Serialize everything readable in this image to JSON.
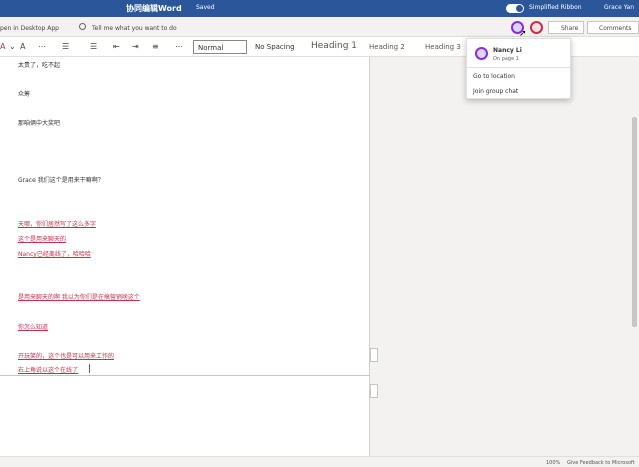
{
  "titlebar": {
    "doc_title": "协同编辑Word",
    "saved": "Saved",
    "simplified_ribbon": "Simplified Ribbon",
    "user": "Grace Yan"
  },
  "ribbon1": {
    "open_desktop": "pen in Desktop App",
    "tell_me": "Tell me what you want to do",
    "share": "Share",
    "comments": "Comments"
  },
  "ribbon2": {
    "styles": [
      "Normal",
      "No Spacing",
      "Heading 1",
      "Heading 2",
      "Heading 3"
    ]
  },
  "document": {
    "lines": [
      {
        "text": "太贵了，吃不起",
        "style": "black"
      },
      {
        "text": "众筹",
        "style": "black"
      },
      {
        "text": "那咱俩中大奖吧",
        "style": "black"
      },
      {
        "text": "Grace 我们这个是用来干嘛啊？",
        "style": "black"
      },
      {
        "text": "天哪，你们居然写了这么多字",
        "style": "red"
      },
      {
        "text": "这个是用来聊天的",
        "style": "red"
      },
      {
        "text": "Nancy已经离线了，哈哈哈",
        "style": "red"
      },
      {
        "text": "是用来聊天的啊 我以为你们是在搞营销啥这个",
        "style": "red"
      },
      {
        "text": "你怎么知道",
        "style": "red"
      },
      {
        "text": "开玩笑的，这个也是可以用来工作的",
        "style": "red"
      },
      {
        "text": "右上角说以这个在线了",
        "style": "red"
      }
    ]
  },
  "popup": {
    "name": "Nancy Li",
    "location": "On page 1",
    "goto": "Go to location",
    "join": "Join group chat"
  },
  "statusbar": {
    "zoom": "100%",
    "feedback": "Give Feedback to Microsoft"
  },
  "colors": {
    "titlebar": "#2b579a",
    "coauthor_nancy": "#8a2be2",
    "coauthor_grace": "#c4314b"
  }
}
